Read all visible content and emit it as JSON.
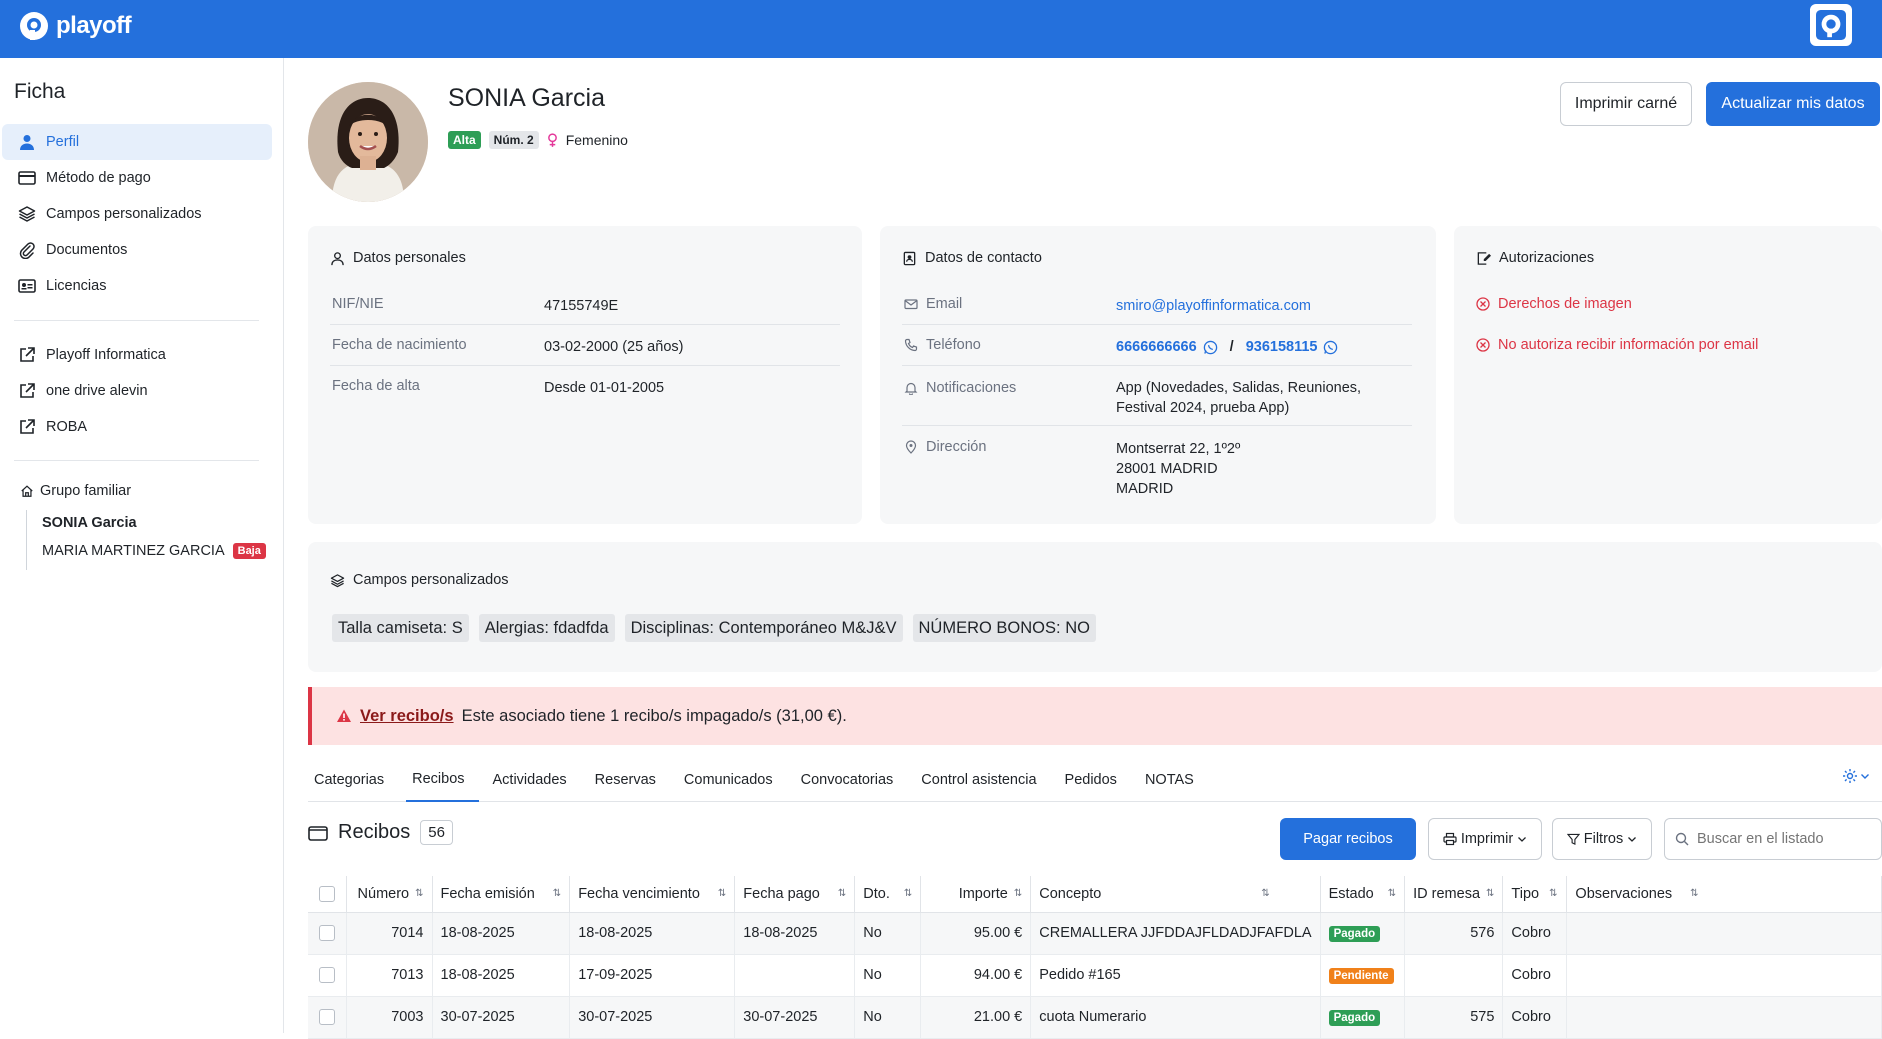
{
  "brand": {
    "name": "playoff",
    "color": "#2470dc"
  },
  "sidebar": {
    "title": "Ficha",
    "items": [
      {
        "label": "Perfil",
        "icon": "user-icon",
        "active": true
      },
      {
        "label": "Método de pago",
        "icon": "credit-card-icon"
      },
      {
        "label": "Campos personalizados",
        "icon": "layers-icon"
      },
      {
        "label": "Documentos",
        "icon": "paperclip-icon"
      },
      {
        "label": "Licencias",
        "icon": "id-card-icon"
      }
    ],
    "links": [
      {
        "label": "Playoff Informatica",
        "icon": "external-link-icon"
      },
      {
        "label": "one drive alevin",
        "icon": "external-link-icon"
      },
      {
        "label": "ROBA",
        "icon": "external-link-icon"
      }
    ],
    "family": {
      "title": "Grupo familiar",
      "members": [
        {
          "name": "SONIA Garcia",
          "bold": true
        },
        {
          "name": "MARIA MARTINEZ GARCIA",
          "badge": "Baja"
        }
      ]
    }
  },
  "profile": {
    "name": "SONIA Garcia",
    "status_tag": "Alta",
    "number_tag": "Núm. 2",
    "gender": "Femenino",
    "print_button": "Imprimir carné",
    "update_button": "Actualizar mis datos"
  },
  "personal": {
    "title": "Datos personales",
    "rows": [
      {
        "label": "NIF/NIE",
        "value": "47155749E"
      },
      {
        "label": "Fecha de nacimiento",
        "value": "03-02-2000 (25 años)"
      },
      {
        "label": "Fecha de alta",
        "value": "Desde 01-01-2005"
      }
    ]
  },
  "contact": {
    "title": "Datos de contacto",
    "email_label": "Email",
    "email": "smiro@playoffinformatica.com",
    "phone_label": "Teléfono",
    "phone1": "6666666666",
    "phone_sep": "/",
    "phone2": "936158115",
    "notif_label": "Notificaciones",
    "notif_line1": "App (Novedades, Salidas, Reuniones,",
    "notif_line2": "Festival 2024, prueba App)",
    "address_label": "Dirección",
    "address_line1": "Montserrat 22, 1º2º",
    "address_line2": "28001 MADRID",
    "address_line3": "MADRID"
  },
  "authorizations": {
    "title": "Autorizaciones",
    "items": [
      "Derechos de imagen",
      "No autoriza recibir información por email"
    ]
  },
  "custom_fields": {
    "title": "Campos personalizados",
    "chips": [
      "Talla camiseta: S",
      "Alergias: fdadfda",
      "Disciplinas: Contemporáneo M&J&V",
      "NÚMERO BONOS: NO"
    ]
  },
  "alert": {
    "link": "Ver recibo/s",
    "text": "Este asociado tiene 1 recibo/s impagado/s (31,00 €)."
  },
  "tabs": [
    "Categorias",
    "Recibos",
    "Actividades",
    "Reservas",
    "Comunicados",
    "Convocatorias",
    "Control asistencia",
    "Pedidos",
    "NOTAS"
  ],
  "active_tab": "Recibos",
  "receipts": {
    "title": "Recibos",
    "count": "56",
    "pay_button": "Pagar recibos",
    "print_button": "Imprimir",
    "filter_button": "Filtros",
    "search_placeholder": "Buscar en el listado",
    "columns": [
      "Número",
      "Fecha emisión",
      "Fecha vencimiento",
      "Fecha pago",
      "Dto.",
      "Importe",
      "Concepto",
      "Estado",
      "ID remesa",
      "Tipo",
      "Observaciones"
    ],
    "rows": [
      {
        "numero": "7014",
        "emision": "18-08-2025",
        "vencimiento": "18-08-2025",
        "pago": "18-08-2025",
        "dto": "No",
        "importe": "95.00 €",
        "concepto": "CREMALLERA JJFDDAJFLDADJFAFDLA",
        "estado": "Pagado",
        "estado_color": "#2e9e56",
        "remesa": "576",
        "tipo": "Cobro",
        "obs": ""
      },
      {
        "numero": "7013",
        "emision": "18-08-2025",
        "vencimiento": "17-09-2025",
        "pago": "",
        "dto": "No",
        "importe": "94.00 €",
        "concepto": "Pedido #165",
        "estado": "Pendiente",
        "estado_color": "#f0811a",
        "remesa": "",
        "tipo": "Cobro",
        "obs": ""
      },
      {
        "numero": "7003",
        "emision": "30-07-2025",
        "vencimiento": "30-07-2025",
        "pago": "30-07-2025",
        "dto": "No",
        "importe": "21.00 €",
        "concepto": "cuota Numerario",
        "estado": "Pagado",
        "estado_color": "#2e9e56",
        "remesa": "575",
        "tipo": "Cobro",
        "obs": ""
      }
    ]
  }
}
